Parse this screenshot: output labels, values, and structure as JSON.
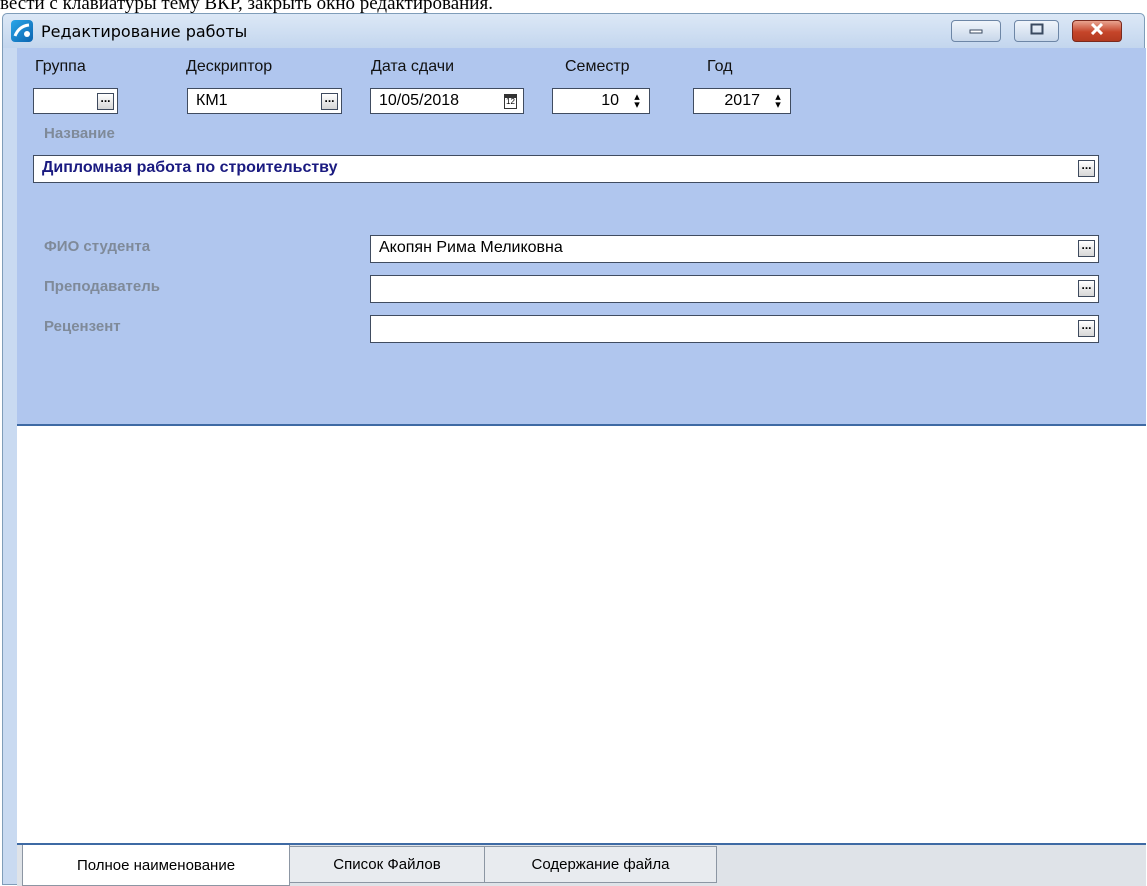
{
  "caption_text": "вести с клавиатуры тему ВКР, закрыть окно редактирования.",
  "window": {
    "title": "Редактирование работы",
    "icon": "app-logo-icon",
    "controls": [
      "minimize-icon",
      "maximize-icon",
      "close-icon"
    ]
  },
  "form": {
    "group": {
      "label": "Группа",
      "value": ""
    },
    "descriptor": {
      "label": "Дескриптор",
      "value": "КМ1"
    },
    "due_date": {
      "label": "Дата сдачи",
      "value": "10/05/2018",
      "icon": "calendar-icon"
    },
    "semester": {
      "label": "Семестр",
      "value": "10",
      "icon": "spinner-icon"
    },
    "year": {
      "label": "Год",
      "value": "2017",
      "icon": "spinner-icon"
    },
    "title": {
      "label": "Название",
      "value": "Дипломная работа по строительству"
    },
    "student": {
      "label": "ФИО студента",
      "value": "Акопян Рима Меликовна"
    },
    "teacher": {
      "label": "Преподаватель",
      "value": ""
    },
    "reviewer": {
      "label": "Рецензент",
      "value": ""
    },
    "ellipsis_label": "..."
  },
  "tabs": [
    {
      "label": "Полное наименование",
      "active": true
    },
    {
      "label": "Список Файлов",
      "active": false
    },
    {
      "label": "Содержание файла",
      "active": false
    }
  ],
  "colors": {
    "form_panel": "#b0c6ee",
    "title_value": "#1a1a80",
    "close_button": "#c5452a"
  }
}
